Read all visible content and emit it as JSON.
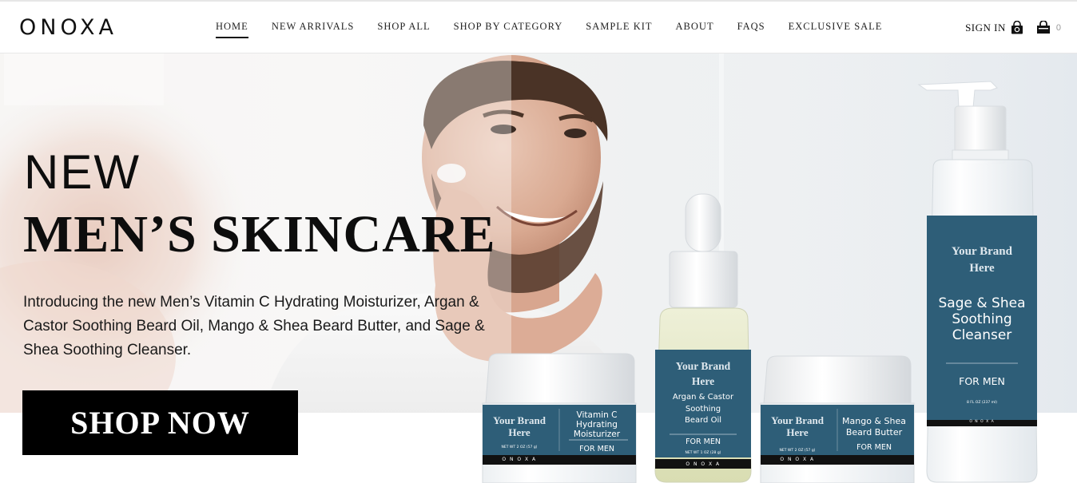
{
  "header": {
    "logo": "ONOXA",
    "nav": [
      {
        "label": "HOME",
        "active": true
      },
      {
        "label": "NEW ARRIVALS",
        "active": false
      },
      {
        "label": "SHOP ALL",
        "active": false
      },
      {
        "label": "SHOP BY CATEGORY",
        "active": false
      },
      {
        "label": "SAMPLE KIT",
        "active": false
      },
      {
        "label": "ABOUT",
        "active": false
      },
      {
        "label": "FAQS",
        "active": false
      },
      {
        "label": "EXCLUSIVE SALE",
        "active": false
      }
    ],
    "sign_in": "SIGN IN",
    "account_icon": "user-bag-icon",
    "cart_icon": "shopping-bag-icon",
    "cart_count": "0"
  },
  "hero": {
    "headline_1": "NEW",
    "headline_2": "MEN’S SKINCARE",
    "intro": "Introducing the new Men’s Vitamin C Hydrating Moisturizer, Argan & Castor Soothing Beard Oil, Mango & Shea Beard Butter, and Sage & Shea Soothing Cleanser.",
    "cta": "SHOP NOW"
  },
  "products": {
    "brand": "Your Brand Here",
    "brand_line1": "Your Brand",
    "brand_line2": "Here",
    "for_men": "FOR MEN",
    "maker": "O N O X A",
    "moisturizer": {
      "name_lines": [
        "Vitamin C",
        "Hydrating",
        "Moisturizer"
      ],
      "net": "NET WT 2 OZ (57 g)"
    },
    "beard_oil": {
      "name_lines": [
        "Argan & Castor",
        "Soothing",
        "Beard Oil"
      ],
      "net": "NET WT 1 OZ (28 g)"
    },
    "beard_butter": {
      "name_lines": [
        "Mango & Shea",
        "Beard Butter"
      ],
      "net": "NET WT 2 OZ (57 g)"
    },
    "cleanser": {
      "name_lines": [
        "Sage & Shea",
        "Soothing",
        "Cleanser"
      ],
      "net": "8 FL OZ (237 ml)"
    }
  },
  "colors": {
    "label_blue": "#2e5e78",
    "label_black": "#111111",
    "cta_bg": "#000000",
    "cta_text": "#ffffff"
  }
}
